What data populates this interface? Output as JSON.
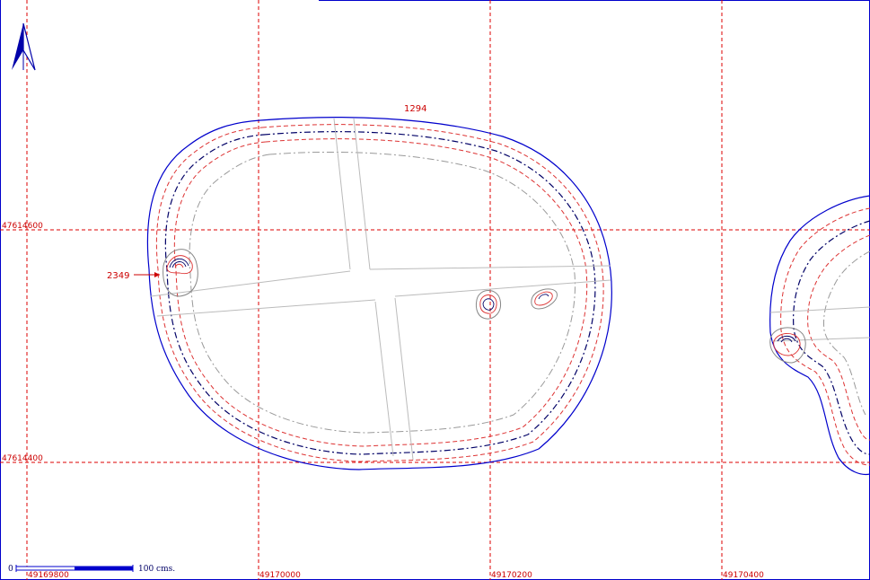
{
  "map": {
    "grid_x_labels": [
      "49169800",
      "49170000",
      "49170200",
      "49170400"
    ],
    "grid_y_labels": [
      "47614600",
      "47614400"
    ],
    "annotations": {
      "pit_label": "2349",
      "feature_label": "1294"
    },
    "scale_bar": {
      "zero_label": "0",
      "length_label": "100 cms."
    },
    "north_icon": "north-arrow-icon",
    "colors": {
      "grid": "#dd0000",
      "outline": "#0000cc",
      "contour_red": "#dd3333",
      "contour_navy": "#000066",
      "contour_grey": "#999999",
      "section": "#bbbbbb",
      "frame": "#0000cc",
      "scale": "#0000cc"
    }
  }
}
